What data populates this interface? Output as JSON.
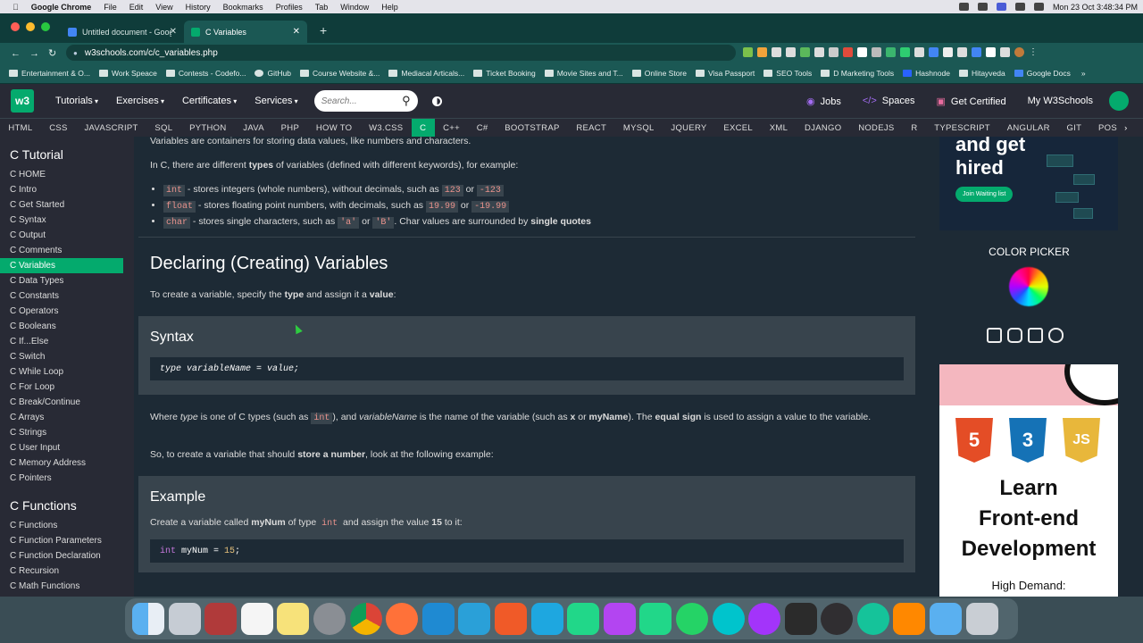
{
  "menubar": {
    "app": "Google Chrome",
    "items": [
      "File",
      "Edit",
      "View",
      "History",
      "Bookmarks",
      "Profiles",
      "Tab",
      "Window",
      "Help"
    ],
    "datetime": "Mon 23 Oct  3:48:34 PM"
  },
  "tabs": [
    {
      "title": "Untitled document - Google D"
    },
    {
      "title": "C Variables"
    }
  ],
  "address": {
    "url": "w3schools.com/c/c_variables.php"
  },
  "bookmarks": [
    "Entertainment & O...",
    "Work Speace",
    "Contests - Codefo...",
    "GitHub",
    "Course Website &...",
    "Mediacal Articals...",
    "Ticket Booking",
    "Movie Sites and T...",
    "Online Store",
    "Visa Passport",
    "SEO Tools",
    "D Marketing Tools",
    "Hashnode",
    "Hitayveda",
    "Google Docs"
  ],
  "w3": {
    "logo": "w3",
    "nav": [
      "Tutorials",
      "Exercises",
      "Certificates",
      "Services"
    ],
    "search_placeholder": "Search...",
    "right": [
      "Jobs",
      "Spaces",
      "Get Certified",
      "My W3Schools"
    ]
  },
  "subnav": [
    "HTML",
    "CSS",
    "JAVASCRIPT",
    "SQL",
    "PYTHON",
    "JAVA",
    "PHP",
    "HOW TO",
    "W3.CSS",
    "C",
    "C++",
    "C#",
    "BOOTSTRAP",
    "REACT",
    "MYSQL",
    "JQUERY",
    "EXCEL",
    "XML",
    "DJANGO",
    "NODEJS",
    "R",
    "TYPESCRIPT",
    "ANGULAR",
    "GIT",
    "POS"
  ],
  "sidebar": {
    "heading": "C Tutorial",
    "items": [
      "C HOME",
      "C Intro",
      "C Get Started",
      "C Syntax",
      "C Output",
      "C Comments",
      "C Variables",
      "C Data Types",
      "C Constants",
      "C Operators",
      "C Booleans",
      "C If...Else",
      "C Switch",
      "C While Loop",
      "C For Loop",
      "C Break/Continue",
      "C Arrays",
      "C Strings",
      "C User Input",
      "C Memory Address",
      "C Pointers"
    ],
    "heading2": "C Functions",
    "items2": [
      "C Functions",
      "C Function Parameters",
      "C Function Declaration",
      "C Recursion",
      "C Math Functions"
    ]
  },
  "content": {
    "intro": "Variables are containers for storing data values, like numbers and characters.",
    "types_a": "In C, there are different ",
    "types_b": "types",
    "types_c": " of variables (defined with different keywords), for example:",
    "b1": {
      "code": "int",
      "a": " - stores integers (whole numbers), without decimals, such as ",
      "v1": "123",
      "or": " or ",
      "v2": "-123"
    },
    "b2": {
      "code": "float",
      "a": " - stores floating point numbers, with decimals, such as ",
      "v1": "19.99",
      "or": " or ",
      "v2": "-19.99"
    },
    "b3": {
      "code": "char",
      "a": " - stores single characters, such as ",
      "v1": "'a'",
      "or": " or ",
      "v2": "'B'",
      "b": ". Char values are surrounded by ",
      "strong": "single quotes"
    },
    "h2": "Declaring (Creating) Variables",
    "p1a": "To create a variable, specify the ",
    "p1b": "type",
    "p1c": " and assign it a ",
    "p1d": "value",
    "p1e": ":",
    "syntax_title": "Syntax",
    "syntax_code": "type variableName = value;",
    "p2a": "Where ",
    "p2b": "type",
    "p2c": " is one of C types (such as ",
    "p2d": "int",
    "p2e": "), and ",
    "p2f": "variableName",
    "p2g": " is the name of the variable (such as ",
    "p2h": "x",
    "p2i": " or ",
    "p2j": "myName",
    "p2k": "). The ",
    "p2l": "equal sign",
    "p2m": " is used to assign a value to the variable.",
    "p3a": "So, to create a variable that should ",
    "p3b": "store a number",
    "p3c": ", look at the following example:",
    "example_title": "Example",
    "ex_a": "Create a variable called ",
    "ex_b": "myNum",
    "ex_c": " of type ",
    "ex_d": "int",
    "ex_e": " and assign the value ",
    "ex_f": "15",
    "ex_g": " to it:",
    "ex_code_kw": "int",
    "ex_code_rest": " myNum = ",
    "ex_code_num": "15",
    "ex_code_end": ";"
  },
  "ads": {
    "hired_top": "and get",
    "hired": "hired",
    "join": "Join Waiting list",
    "color_picker": "COLOR PICKER",
    "html5": "5",
    "css3": "3",
    "js": "JS",
    "learn": "Learn",
    "frontend": "Front-end",
    "development": "Development",
    "demand": "High Demand:"
  },
  "colors": {
    "w3green": "#04aa6d",
    "chrome_tab": "#1b5854"
  }
}
